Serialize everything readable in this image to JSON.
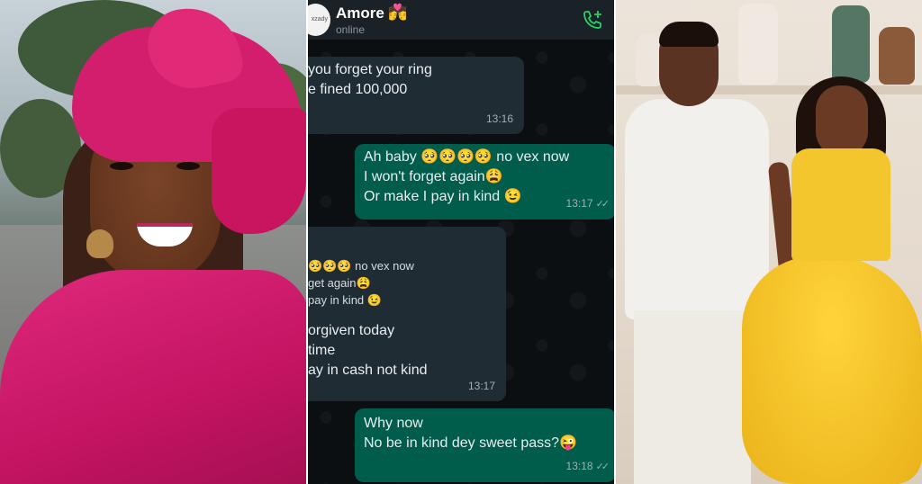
{
  "chat": {
    "contact_name": "Amore",
    "contact_emoji": "💏",
    "status": "online",
    "avatar_text": "xzady",
    "messages": [
      {
        "direction": "incoming",
        "lines": [
          "you forget your ring",
          "e fined 100,000"
        ],
        "time": "13:16"
      },
      {
        "direction": "outgoing",
        "lines": [
          "Ah baby 🥺🥺🥺🥺 no vex now",
          "I won't forget again😩",
          "Or make I pay in kind 😉"
        ],
        "time": "13:17",
        "ticks": "✓✓"
      },
      {
        "direction": "incoming",
        "quoted_lines": [
          "🥺🥺🥺 no vex now",
          "get again😩",
          "pay in kind 😉"
        ],
        "lines": [
          "orgiven today",
          "time",
          "ay in cash not kind"
        ],
        "time": "13:17"
      },
      {
        "direction": "outgoing",
        "lines": [
          "Why now",
          "No be in kind dey sweet pass?😜"
        ],
        "time": "13:18",
        "ticks": "✓✓"
      }
    ]
  },
  "colors": {
    "chat_background": "#0b0f12",
    "header_background": "#1b2227",
    "incoming_bubble": "#1f2c33",
    "outgoing_bubble": "#005c4b",
    "call_icon": "#25d366",
    "scarf_pink": "#d21e6c",
    "dress_yellow": "#f4c62e"
  },
  "icons": {
    "call": "add-call-icon"
  }
}
